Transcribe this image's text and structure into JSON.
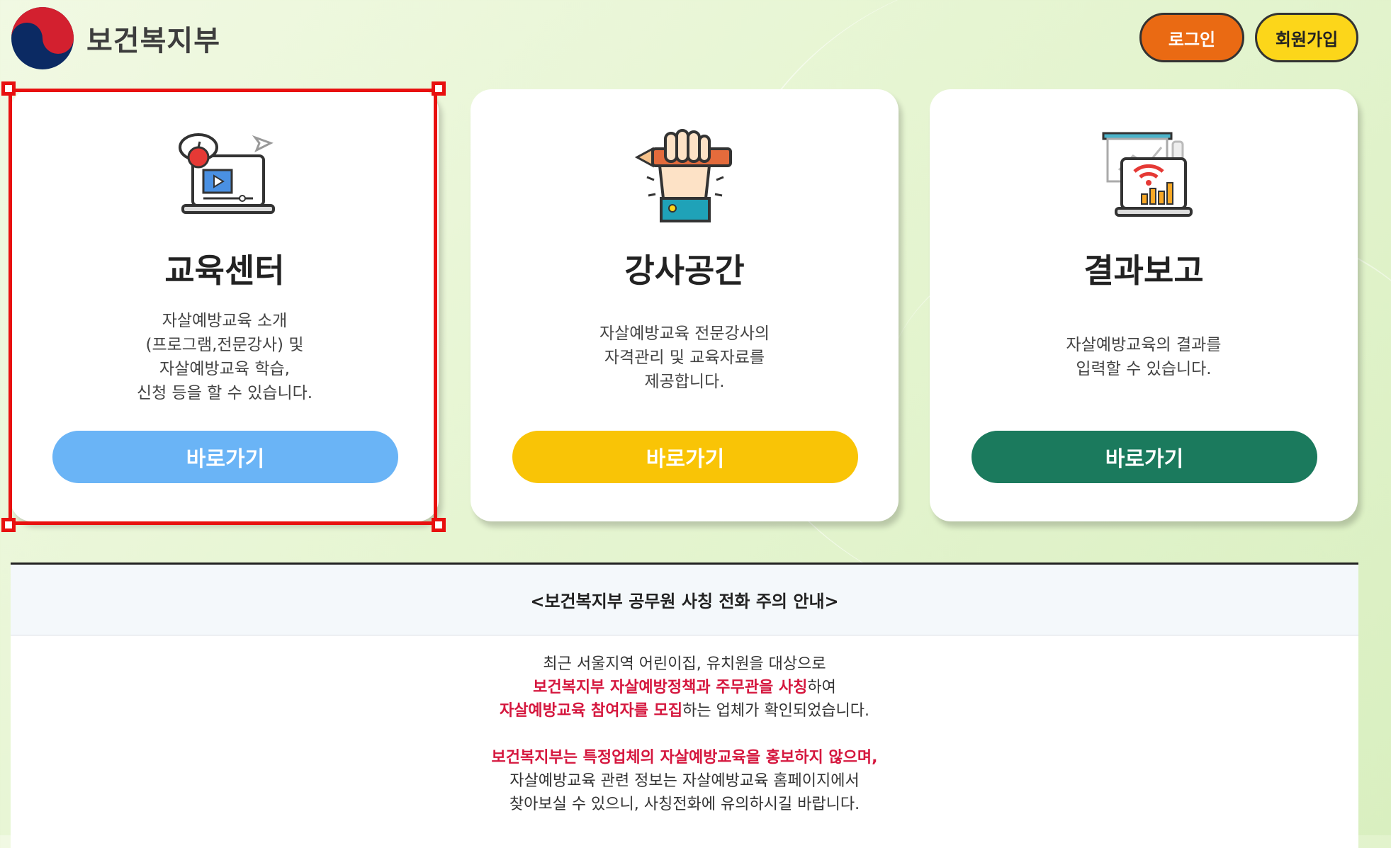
{
  "header": {
    "org_name": "보건복지부",
    "login_label": "로그인",
    "join_label": "회원가입"
  },
  "cards": [
    {
      "title": "교육센터",
      "description": "자살예방교육 소개\n(프로그램,전문강사) 및\n자살예방교육 학습,\n신청 등을 할 수 있습니다.",
      "button_label": "바로가기",
      "icon": "laptop-video-icon",
      "button_color": "#6ab4f6"
    },
    {
      "title": "강사공간",
      "description": "자살예방교육 전문강사의\n자격관리 및 교육자료를\n제공합니다.",
      "button_label": "바로가기",
      "icon": "hand-pencil-icon",
      "button_color": "#f9c406"
    },
    {
      "title": "결과보고",
      "description": "자살예방교육의 결과를\n입력할 수 있습니다.",
      "button_label": "바로가기",
      "icon": "chart-report-icon",
      "button_color": "#1b7a5d"
    }
  ],
  "notice": {
    "title": "<보건복지부 공무원 사칭 전화 주의 안내>",
    "p1_line1": "최근 서울지역 어린이집, 유치원을 대상으로",
    "p1_line2_red": "보건복지부 자살예방정책과 주무관을 사칭",
    "p1_line2_tail": "하여",
    "p1_line3_red": "자살예방교육 참여자를 모집",
    "p1_line3_tail": "하는 업체가 확인되었습니다.",
    "p2_line1_red": "보건복지부는 특정업체의 자살예방교육을 홍보하지 않으며,",
    "p2_line2": "자살예방교육 관련 정보는 자살예방교육 홈페이지에서",
    "p2_line3": "찾아보실 수 있으니, 사칭전화에 유의하시길 바랍니다."
  },
  "colors": {
    "accent_red": "#d5173e",
    "login_bg": "#ea6a13",
    "join_bg": "#fcd61a",
    "selection": "#e8100f"
  }
}
